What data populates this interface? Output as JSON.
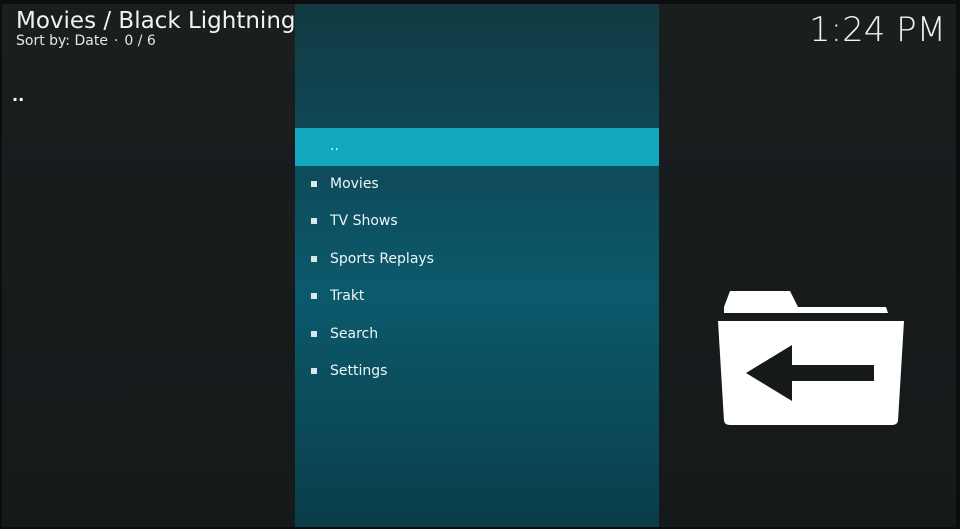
{
  "header": {
    "title": "Movies / Black Lightning",
    "sort_label": "Sort by: Date",
    "separator": "·",
    "count": "0 / 6"
  },
  "clock": {
    "time": "1:24 PM"
  },
  "left_list": {
    "parent_label": ".."
  },
  "menu": {
    "items": [
      {
        "label": "..",
        "selected": true
      },
      {
        "label": "Movies"
      },
      {
        "label": "TV Shows"
      },
      {
        "label": "Sports Replays"
      },
      {
        "label": "Trakt"
      },
      {
        "label": "Search"
      },
      {
        "label": "Settings"
      }
    ]
  },
  "colors": {
    "selected_row": "#13a6bf",
    "panel_top": "#123a42",
    "panel_mid": "#0b5a6c",
    "background": "#15191a"
  },
  "icons": {
    "large_icon": "folder-back-icon"
  }
}
